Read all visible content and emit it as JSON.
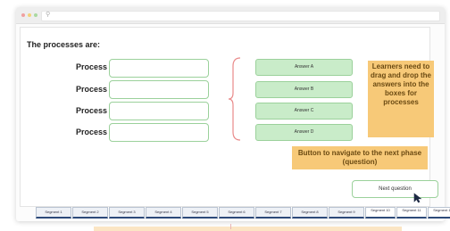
{
  "window": {
    "dots": [
      "#f0a0a0",
      "#f3d27a",
      "#a9d9a0"
    ]
  },
  "heading": "The processes are:",
  "processes": [
    "Process",
    "Process",
    "Process",
    "Process"
  ],
  "answers": [
    "Answer A",
    "Answer B",
    "Answer C",
    "Answer D"
  ],
  "notes": {
    "drag": "Learners need to drag and drop the answers into the boxes for processes",
    "navigate": "Button to navigate to the next phase (question)"
  },
  "next_button": "Next question",
  "segments": [
    "Segment 1",
    "Segment 2",
    "Segment 3",
    "Segment 4",
    "Segment 5",
    "Segment 6",
    "Segment 7",
    "Segment 8",
    "Segment 9",
    "Segment 10",
    "Segment 11",
    "Segment 12"
  ],
  "colors": {
    "answer_fill": "#c9ecc9",
    "border_green": "#9bd19b",
    "note_orange": "#f7c978",
    "bracket_red": "#e98a8a",
    "tab_border": "#2d4a7a"
  }
}
